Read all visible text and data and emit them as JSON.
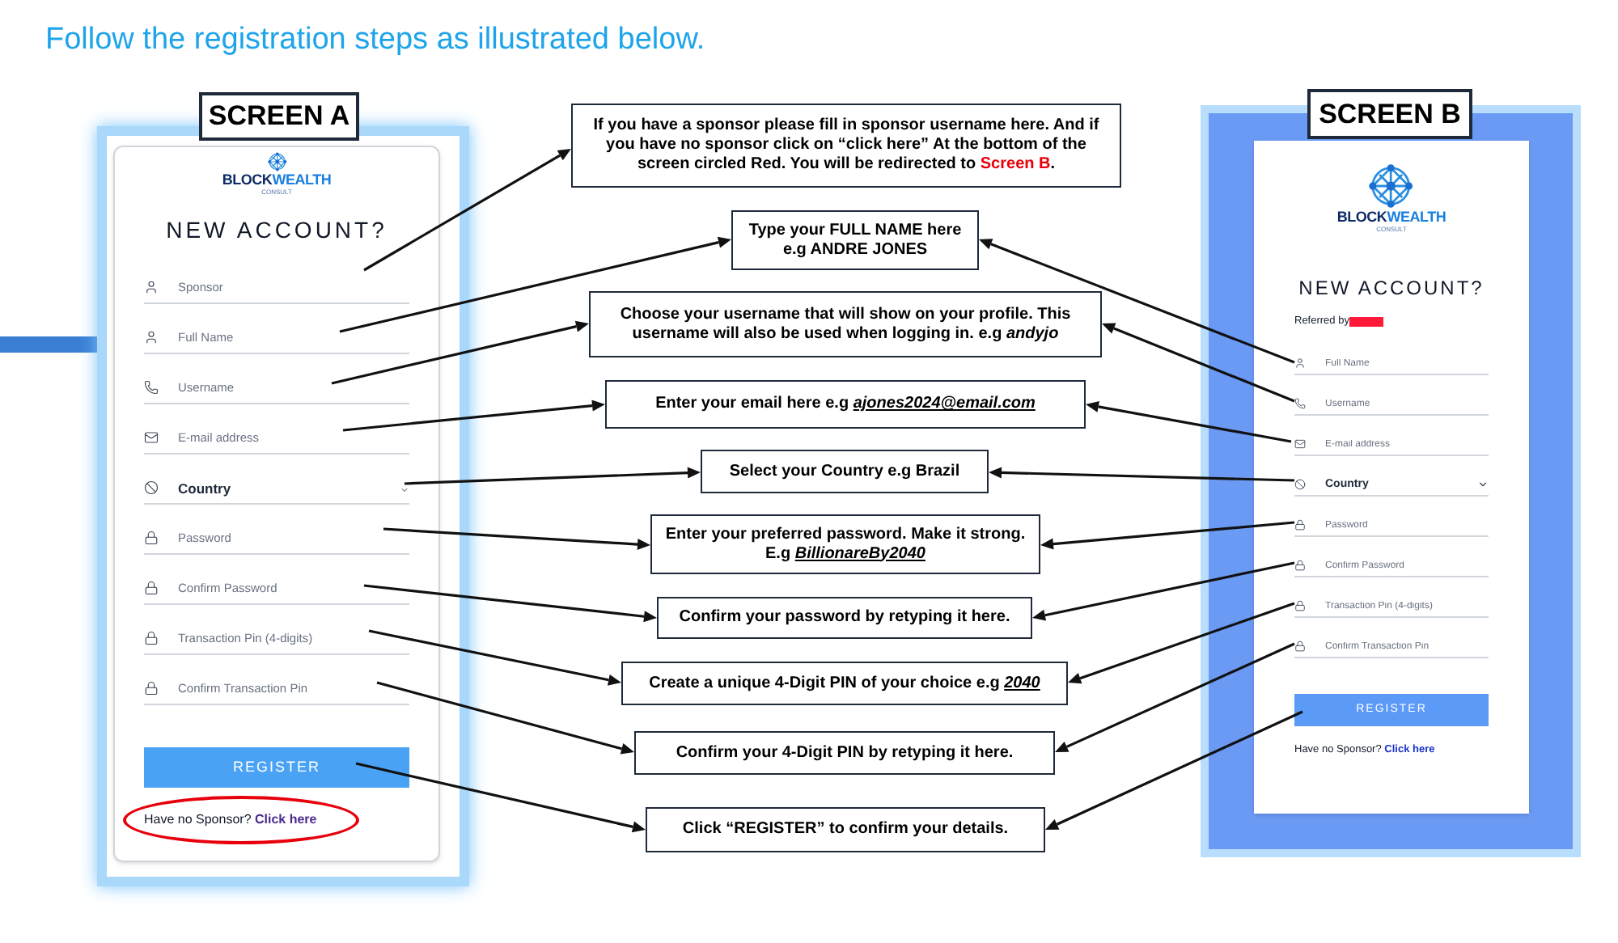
{
  "title": "Follow the registration steps as illustrated below.",
  "screen_a": {
    "label": "SCREEN A",
    "logo": {
      "first": "BLOCK",
      "second": "WEALTH",
      "sub": "CONSULT"
    },
    "heading": "NEW ACCOUNT?",
    "fields": [
      {
        "kind": "name",
        "placeholder": "Sponsor"
      },
      {
        "kind": "name",
        "placeholder": "Full Name"
      },
      {
        "kind": "username",
        "placeholder": "Username"
      },
      {
        "kind": "email",
        "placeholder": "E-mail address"
      },
      {
        "kind": "select",
        "value": "Country"
      },
      {
        "kind": "password",
        "placeholder": "Password"
      },
      {
        "kind": "password",
        "placeholder": "Confirm Password"
      },
      {
        "kind": "password",
        "placeholder": "Transaction Pin (4-digits)"
      },
      {
        "kind": "password",
        "placeholder": "Confirm Transaction Pin"
      }
    ],
    "button": "REGISTER",
    "footer": {
      "text": "Have no Sponsor?",
      "link": "Click here",
      "circled": true
    }
  },
  "callouts": [
    {
      "parts": [
        {
          "kind": "plain",
          "text": "If you have a sponsor please fill in sponsor username here. And if you have no sponsor click on “click here” At the bottom of the screen circled Red. You will be redirected to "
        },
        {
          "kind": "red",
          "text": "Screen B"
        },
        {
          "kind": "plain",
          "text": "."
        }
      ]
    },
    {
      "parts": [
        {
          "kind": "plain",
          "text": "Type your FULL NAME here e.g ANDRE JONES"
        }
      ]
    },
    {
      "parts": [
        {
          "kind": "plain",
          "text": "Choose your username that will show on your profile. This username will also be used when logging in. e.g "
        },
        {
          "kind": "italic",
          "text": "andyjo"
        }
      ]
    },
    {
      "parts": [
        {
          "kind": "plain",
          "text": "Enter your email here e.g "
        },
        {
          "kind": "example",
          "text": "ajones2024@email.com"
        }
      ]
    },
    {
      "parts": [
        {
          "kind": "plain",
          "text": "Select your Country e.g Brazil"
        }
      ]
    },
    {
      "parts": [
        {
          "kind": "plain",
          "text": "Enter your preferred password. Make it strong. E.g "
        },
        {
          "kind": "example",
          "text": "BillionareBy2040"
        }
      ]
    },
    {
      "parts": [
        {
          "kind": "plain",
          "text": "Confirm your password by retyping it here."
        }
      ]
    },
    {
      "parts": [
        {
          "kind": "plain",
          "text": "Create a unique 4-Digit PIN of your choice e.g "
        },
        {
          "kind": "example",
          "text": "2040"
        }
      ]
    },
    {
      "parts": [
        {
          "kind": "plain",
          "text": "Confirm your 4-Digit PIN by retyping it here."
        }
      ]
    },
    {
      "parts": [
        {
          "kind": "plain",
          "text": "Click “REGISTER” to confirm your details."
        }
      ]
    }
  ],
  "screen_b": {
    "label": "SCREEN B",
    "logo": {
      "first": "BLOCK",
      "second": "WEALTH",
      "sub": "CONSULT"
    },
    "heading": "NEW ACCOUNT?",
    "referred_by": "Referred by",
    "referrer_redacted": true,
    "fields": [
      {
        "kind": "name",
        "placeholder": "Full Name"
      },
      {
        "kind": "username",
        "placeholder": "Username"
      },
      {
        "kind": "email",
        "placeholder": "E-mail address"
      },
      {
        "kind": "select",
        "value": "Country"
      },
      {
        "kind": "password",
        "placeholder": "Password"
      },
      {
        "kind": "password",
        "placeholder": "Confirm Password"
      },
      {
        "kind": "password",
        "placeholder": "Transaction Pin (4-digits)"
      },
      {
        "kind": "password",
        "placeholder": "Confirm Transaction Pin"
      }
    ],
    "button": "REGISTER",
    "footer": {
      "text": "Have no Sponsor?",
      "link": "Click here",
      "circled": false
    }
  }
}
